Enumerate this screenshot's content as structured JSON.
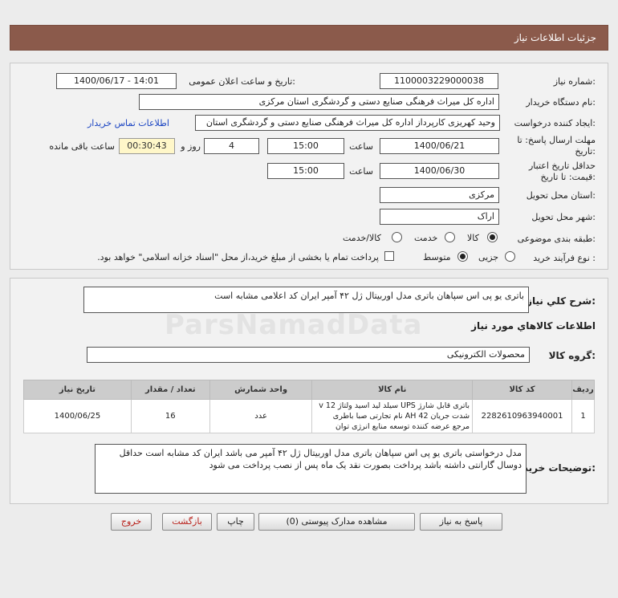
{
  "header": {
    "title": "جزئیات اطلاعات نیاز"
  },
  "form": {
    "need_number_label": "شماره نیاز:",
    "need_number": "1100003229000038",
    "announce_label": "تاریخ و ساعت اعلان عمومی:",
    "announce_value": "1400/06/17 - 14:01",
    "buyer_org_label": "نام دستگاه خریدار:",
    "buyer_org": "اداره کل میراث فرهنگی  صنایع دستی و گردشگری استان مرکزی",
    "requester_label": "ایجاد کننده درخواست:",
    "requester": "وحید کهریزی کارپرداز اداره کل میراث فرهنگی  صنایع دستی و گردشگری استان",
    "contact_link": "اطلاعات تماس خریدار",
    "deadline_label_1": "مهلت ارسال پاسخ: تا",
    "deadline_label_2": "تاریخ:",
    "deadline_date": "1400/06/21",
    "time_label": "ساعت",
    "deadline_time": "15:00",
    "days": "4",
    "days_label": "روز و",
    "remaining": "00:30:43",
    "remaining_label": "ساعت باقی مانده",
    "validity_label_1": "حداقل تاریخ اعتبار",
    "validity_label_2": "قیمت: تا تاریخ:",
    "validity_date": "1400/06/30",
    "validity_time_label": "ساعت",
    "validity_time": "15:00",
    "province_label": "استان محل تحویل:",
    "province": "مرکزی",
    "city_label": "شهر محل تحویل:",
    "city": "اراک",
    "category_label": "طبقه بندی موضوعی:",
    "category_options": [
      "کالا",
      "خدمت",
      "کالا/خدمت"
    ],
    "process_label": "نوع فرآیند خرید :",
    "process_options": [
      "جزیی",
      "متوسط"
    ],
    "payment_note": "پرداخت تمام یا بخشی از مبلغ خرید،از محل \"اسناد خزانه اسلامی\" خواهد بود."
  },
  "details": {
    "general_label": "شرح کلي نياز:",
    "general_text": "باتری یو پی اس سپاهان باتری مدل اوربیتال ژل ۴۲ آمپر ایران کد اعلامی مشابه است",
    "items_title": "اطلاعات کالاهاي مورد نياز",
    "group_label": "گروه کالا:",
    "group_value": "محصولات الکترونیکی",
    "table": {
      "headers": [
        "ردیف",
        "کد کالا",
        "نام کالا",
        "واحد شمارش",
        "تعداد / مقدار",
        "تاریخ نیاز"
      ],
      "rows": [
        {
          "row": "1",
          "code": "2282610963940001",
          "name": "باتری قابل شارژ UPS سیلد لید اسید ولتاژ 12 v شدت جریان 42 AH نام تجارتی صبا باطری مرجع عرضه کننده توسعه منابع انرژی توان",
          "unit": "عدد",
          "qty": "16",
          "date": "1400/06/25"
        }
      ]
    },
    "buyer_notes_label": "توضیحات خریدار:",
    "buyer_notes": "مدل درخواستی باتری یو پی اس سپاهان باتری مدل اوربیتال ژل ۴۲ آمپر می باشد ایران کد مشابه است حداقل دوسال گارانتی داشته باشد پرداخت بصورت نقد یک ماه پس از نصب پرداخت می شود"
  },
  "buttons": {
    "reply": "پاسخ به نیاز",
    "attachments": "مشاهده مدارک پیوستی (0)",
    "print": "چاپ",
    "back": "بازگشت",
    "exit": "خروج"
  }
}
